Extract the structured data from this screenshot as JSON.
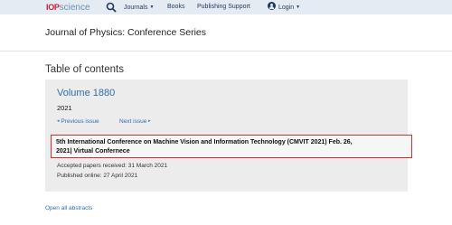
{
  "topbar": {
    "brand_prefix": "IOP",
    "brand_suffix": "science",
    "nav": {
      "journals": "Journals",
      "books": "Books",
      "publishing_support": "Publishing Support",
      "login": "Login"
    },
    "icons": [
      "search-icon",
      "user-icon",
      "chevron-down-icon"
    ]
  },
  "journal": {
    "title": "Journal of Physics: Conference Series"
  },
  "toc": {
    "heading": "Table of contents",
    "volume": "Volume 1880",
    "year": "2021",
    "previous_issue": "Previous issue",
    "next_issue": "Next issue",
    "conference_line1": "5th International Conference on Machine Vision and Information Technology (CMVIT 2021) Feb. 26,",
    "conference_line2": "2021| Virtual Confernece",
    "accepted": "Accepted papers received: 31 March 2021",
    "published": "Published online: 27 April 2021"
  },
  "links": {
    "open_all_abstracts": "Open all abstracts"
  },
  "colors": {
    "topbar_bg": "#e4ebf2",
    "link": "#2f6fa8",
    "highlight_border": "#d32f2f",
    "brand_red": "#c6203b"
  }
}
